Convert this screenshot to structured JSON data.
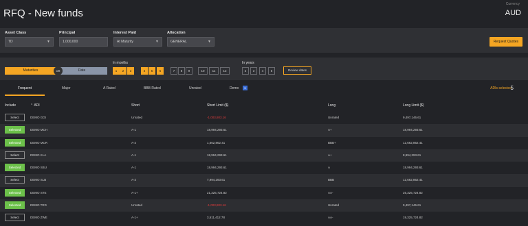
{
  "header": {
    "title": "RFQ - New funds",
    "currency_label": "Currency",
    "currency": "AUD"
  },
  "filters": {
    "asset_class": {
      "label": "Asset Class",
      "value": "TD"
    },
    "principal": {
      "label": "Principal",
      "value": "1,000,000"
    },
    "interest_paid": {
      "label": "Interest Paid",
      "value": "At Maturity"
    },
    "allocation": {
      "label": "Allocation",
      "value": "GENERAL"
    },
    "request_quotes": "Request Quotes"
  },
  "terms": {
    "toggle": {
      "left": "Maturities",
      "right": "Date",
      "knob": "OR"
    },
    "months_label": "In months",
    "months": [
      {
        "n": "1",
        "on": true
      },
      {
        "n": "2",
        "on": true
      },
      {
        "n": "3",
        "on": true
      },
      {
        "n": "4",
        "on": true
      },
      {
        "n": "5",
        "on": true
      },
      {
        "n": "6",
        "on": true
      },
      {
        "n": "7",
        "on": false
      },
      {
        "n": "8",
        "on": false
      },
      {
        "n": "9",
        "on": false
      },
      {
        "n": "10",
        "on": false
      },
      {
        "n": "11",
        "on": false
      },
      {
        "n": "12",
        "on": false
      }
    ],
    "years_label": "In years",
    "years": [
      "2",
      "3",
      "4",
      "5"
    ],
    "review_dates": "Review dates"
  },
  "tabs": {
    "items": [
      "Frequent",
      "Major",
      "A Rated",
      "BBB Rated",
      "Unrated",
      "Demo"
    ],
    "demo_badge": "S",
    "adis_selected_label": "ADIs selected",
    "adis_selected_count": "5"
  },
  "table": {
    "headers": {
      "include": "Include",
      "adi": "ADI",
      "short": "Short",
      "short_limit": "Short Limit ($)",
      "long": "Long",
      "long_limit": "Long Limit ($)"
    },
    "rows": [
      {
        "btn": "Select",
        "selected": false,
        "adi": "DEMO GGI",
        "short": "Unrated",
        "short_limit": "-1,003,803.16",
        "neg": true,
        "long": "Unrated",
        "long_limit": "9,497,146.61"
      },
      {
        "btn": "Selected",
        "selected": true,
        "adi": "DEMO MCH",
        "short": "A-1",
        "short_limit": "18,994,293.61",
        "neg": false,
        "long": "A+",
        "long_limit": "18,994,293.61"
      },
      {
        "btn": "Selected",
        "selected": true,
        "adi": "DEMO MCR",
        "short": "A-2",
        "short_limit": "1,662,862.41",
        "neg": false,
        "long": "BBB+",
        "long_limit": "12,662,862.41"
      },
      {
        "btn": "Select",
        "selected": false,
        "adi": "DEMO KLA",
        "short": "A-1",
        "short_limit": "18,994,293.61",
        "neg": false,
        "long": "A+",
        "long_limit": "8,994,293.61"
      },
      {
        "btn": "Selected",
        "selected": true,
        "adi": "DEMO SBU",
        "short": "A-1",
        "short_limit": "18,994,293.61",
        "neg": false,
        "long": "A",
        "long_limit": "18,994,293.61"
      },
      {
        "btn": "Select",
        "selected": false,
        "adi": "DEMO SLB",
        "short": "A-2",
        "short_limit": "7,994,293.61",
        "neg": false,
        "long": "BBB",
        "long_limit": "12,662,862.41"
      },
      {
        "btn": "Selected",
        "selected": true,
        "adi": "DEMO STE",
        "short": "A-1+",
        "short_limit": "21,325,724.82",
        "neg": false,
        "long": "AA-",
        "long_limit": "25,325,724.82"
      },
      {
        "btn": "Selected",
        "selected": true,
        "adi": "DEMO TRD",
        "short": "Unrated",
        "short_limit": "-1,003,803.16",
        "neg": true,
        "long": "Unrated",
        "long_limit": "9,497,146.61"
      },
      {
        "btn": "Select",
        "selected": false,
        "adi": "DEMO ZWE",
        "short": "A-1+",
        "short_limit": "3,511,412.78",
        "neg": false,
        "long": "AA-",
        "long_limit": "19,325,724.82"
      }
    ]
  }
}
